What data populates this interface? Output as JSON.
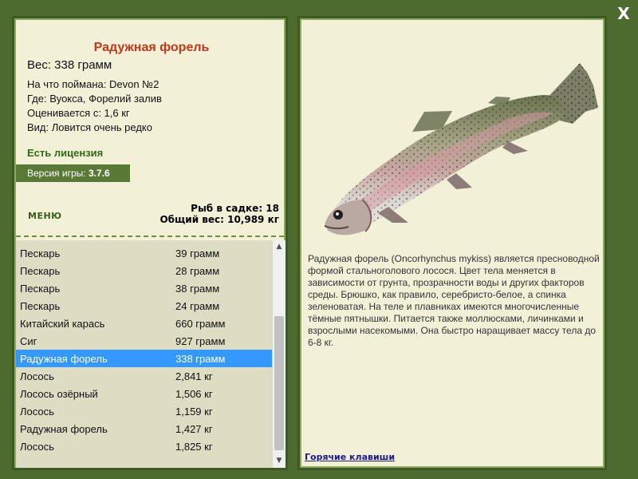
{
  "window": {
    "close_icon": "close-icon",
    "close_glyph": "X"
  },
  "left": {
    "fish_title": "Радужная форель",
    "weight_line": "Вес: 338 грамм",
    "info": [
      "На что поймана: Devon №2",
      "Где: Вуокса, Форелий залив",
      "Оценивается с: 1,6 кг",
      "Вид: Ловится очень редко"
    ],
    "license": "Есть лицензия",
    "version_label": "Версия игры:",
    "version_value": "3.7.6",
    "menu_label": "МЕНЮ",
    "stats": {
      "count": "Рыб в садке: 18",
      "total_weight": "Общий вес: 10,989 кг"
    }
  },
  "catch_list": [
    {
      "name": "Пескарь",
      "weight": "39 грамм"
    },
    {
      "name": "Пескарь",
      "weight": "28 грамм"
    },
    {
      "name": "Пескарь",
      "weight": "38 грамм"
    },
    {
      "name": "Пескарь",
      "weight": "24 грамм"
    },
    {
      "name": "Китайский карась",
      "weight": "660 грамм"
    },
    {
      "name": "Сиг",
      "weight": "927 грамм"
    },
    {
      "name": "Радужная форель",
      "weight": "338 грамм",
      "selected": true
    },
    {
      "name": "Лосось",
      "weight": "2,841 кг"
    },
    {
      "name": "Лосось озёрный",
      "weight": "1,506 кг"
    },
    {
      "name": "Лосось",
      "weight": "1,159 кг"
    },
    {
      "name": "Радужная форель",
      "weight": "1,427 кг"
    },
    {
      "name": "Лосось",
      "weight": "1,825 кг"
    }
  ],
  "right": {
    "description": "Радужная форель (Oncorhynchus mykiss) является пресноводной формой стальноголового лосося. Цвет тела меняется в зависимости от грунта, прозрачности воды и других факторов среды. Брюшко, как правило, серебристо-белое, а спинка зеленоватая. На теле и плавниках имеются многочисленные тёмные пятнышки. Питается также моллюсками, личинками и взрослыми насекомыми. Она быстро наращивает массу тела до 6-8 кг.",
    "hotkeys_link": "Горячие клавиши"
  },
  "colors": {
    "background": "#4d6b2f",
    "panel": "#f3f0d8",
    "title": "#c0391b",
    "license": "#2e6b12",
    "selection": "#3399ff",
    "link": "#1a1a8c"
  }
}
